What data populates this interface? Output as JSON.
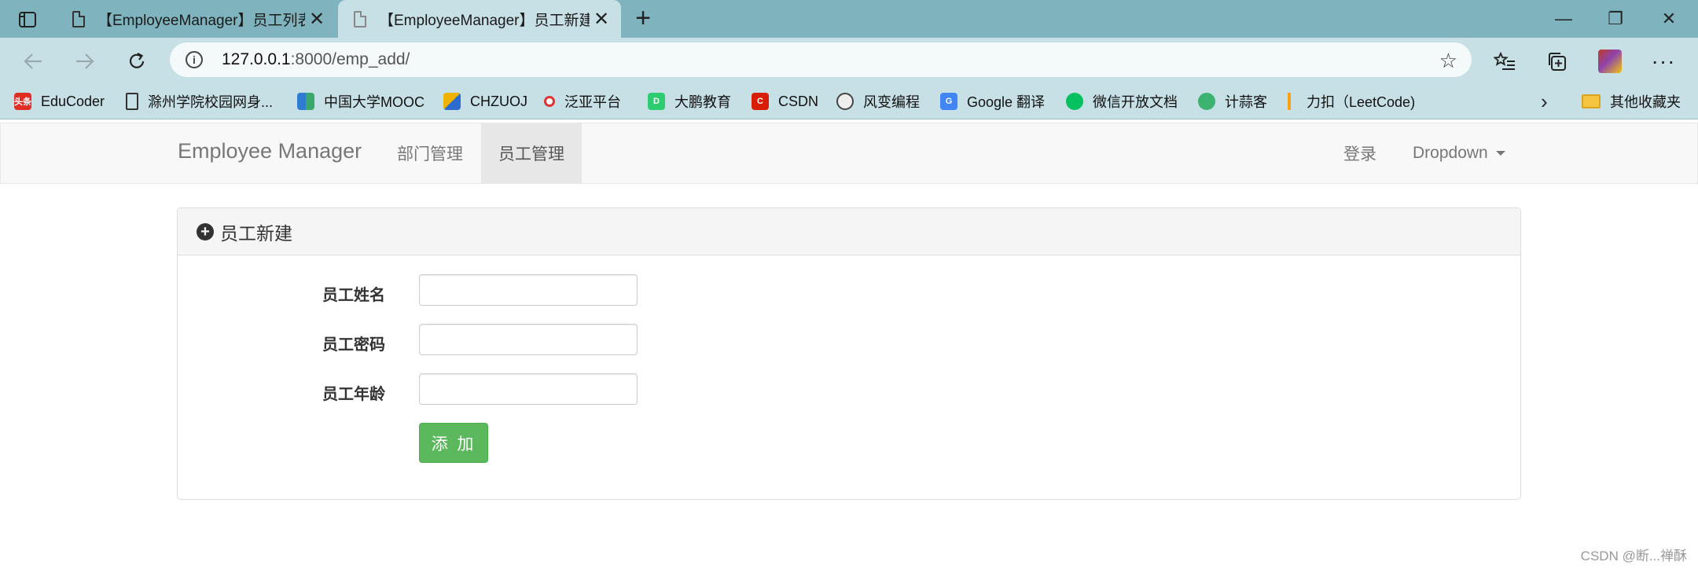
{
  "browser": {
    "tabs": [
      {
        "title": "【EmployeeManager】员工列表",
        "close": "✕"
      },
      {
        "title": "【EmployeeManager】员工新建",
        "close": "✕"
      }
    ],
    "new_tab": "+",
    "window_controls": {
      "minimize": "—",
      "maximize": "❐",
      "close": "✕"
    },
    "address": {
      "host": "127.0.0.1",
      "path": ":8000/emp_add/"
    },
    "bookmarks": [
      {
        "label": "EduCoder",
        "icon": "toutiao-icon",
        "color": "#e02e24",
        "glyph": "头条"
      },
      {
        "label": "滁州学院校园网身...",
        "icon": "document-icon",
        "color": "#ffffff",
        "glyph": ""
      },
      {
        "label": "中国大学MOOC",
        "icon": "mooc-icon",
        "color": "#2e7dd1",
        "glyph": ""
      },
      {
        "label": "CHZUOJ",
        "icon": "chzuoj-icon",
        "color": "#f0b400",
        "glyph": ""
      },
      {
        "label": "泛亚平台",
        "icon": "fanya-icon",
        "color": "#d33",
        "glyph": ""
      },
      {
        "label": "大鹏教育",
        "icon": "dapeng-icon",
        "color": "#2ecc71",
        "glyph": "D"
      },
      {
        "label": "CSDN",
        "icon": "csdn-icon",
        "color": "#d81e06",
        "glyph": "C"
      },
      {
        "label": "风变编程",
        "icon": "panda-icon",
        "color": "#444444",
        "glyph": "🐼"
      },
      {
        "label": "Google 翻译",
        "icon": "google-translate-icon",
        "color": "#4285f4",
        "glyph": "G"
      },
      {
        "label": "微信开放文档",
        "icon": "wechat-icon",
        "color": "#07c160",
        "glyph": ""
      },
      {
        "label": "计蒜客",
        "icon": "jisuanke-icon",
        "color": "#3cb371",
        "glyph": ""
      },
      {
        "label": "力扣（LeetCode)",
        "icon": "leetcode-icon",
        "color": "#ffa116",
        "glyph": ""
      }
    ],
    "bookmarks_more": "›",
    "other_bookmarks": "其他收藏夹"
  },
  "navbar": {
    "brand": "Employee Manager",
    "links": {
      "dept": "部门管理",
      "emp": "员工管理"
    },
    "login": "登录",
    "dropdown": "Dropdown"
  },
  "panel": {
    "title": "员工新建",
    "fields": [
      {
        "label": "员工姓名",
        "value": ""
      },
      {
        "label": "员工密码",
        "value": ""
      },
      {
        "label": "员工年龄",
        "value": ""
      }
    ],
    "submit": "添 加"
  },
  "watermark": "CSDN @断...禅酥"
}
